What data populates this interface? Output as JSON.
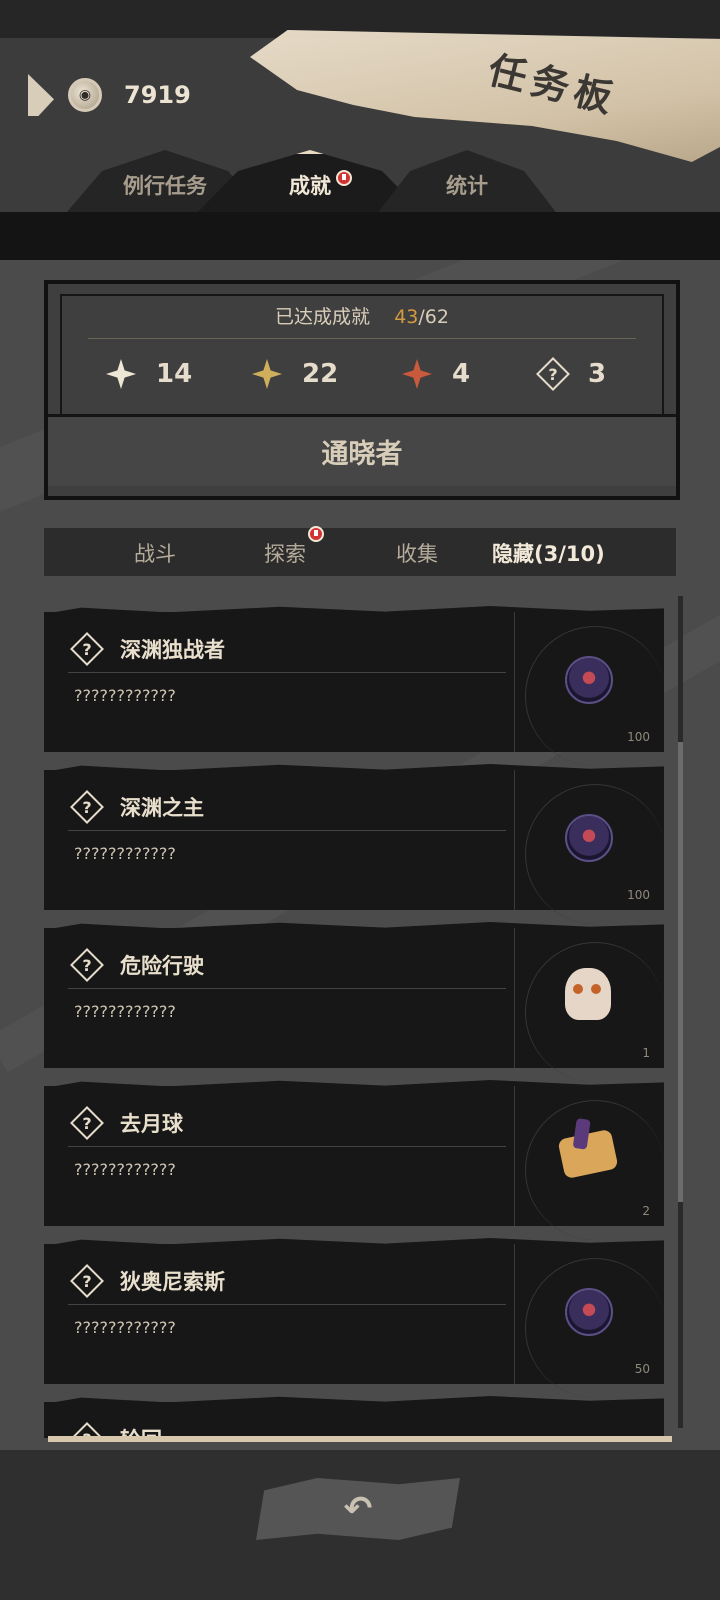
{
  "header": {
    "title": "任务板",
    "coins": "7919",
    "tabs": [
      {
        "label": "例行任务",
        "active": false,
        "badge": false
      },
      {
        "label": "成就",
        "active": true,
        "badge": true
      },
      {
        "label": "统计",
        "active": false,
        "badge": false
      }
    ]
  },
  "summary": {
    "label": "已达成成就",
    "current": "43",
    "separator": "/",
    "total": "62",
    "stats": [
      {
        "icon": "white-star-icon",
        "color": "#efe7d6",
        "value": "14"
      },
      {
        "icon": "gold-star-icon",
        "color": "#cfae5c",
        "value": "22"
      },
      {
        "icon": "red-star-icon",
        "color": "#c95a3c",
        "value": "4"
      },
      {
        "icon": "hidden-question-icon",
        "value": "3"
      }
    ],
    "earned_title": "通晓者"
  },
  "categories": [
    {
      "label": "战斗",
      "active": false,
      "badge": false
    },
    {
      "label": "探索",
      "active": false,
      "badge": true
    },
    {
      "label": "收集",
      "active": false,
      "badge": false
    },
    {
      "label": "隐藏(3/10)",
      "active": true,
      "badge": false
    }
  ],
  "achievements": [
    {
      "title": "深渊独战者",
      "desc": "????????????",
      "reward": "orb-icon",
      "count": "100"
    },
    {
      "title": "深渊之主",
      "desc": "????????????",
      "reward": "orb-icon",
      "count": "100"
    },
    {
      "title": "危险行驶",
      "desc": "????????????",
      "reward": "skull-icon",
      "count": "1"
    },
    {
      "title": "去月球",
      "desc": "????????????",
      "reward": "scroll-icon",
      "count": "2"
    },
    {
      "title": "狄奥尼索斯",
      "desc": "????????????",
      "reward": "orb-icon",
      "count": "50"
    },
    {
      "title": "轮回",
      "desc": "",
      "reward": "",
      "count": ""
    }
  ],
  "footer": {
    "back_icon": "back-arrow-icon"
  },
  "colors": {
    "accent_orange": "#d39a3f",
    "badge_red": "#d23434",
    "paper": "#dac9ad"
  }
}
